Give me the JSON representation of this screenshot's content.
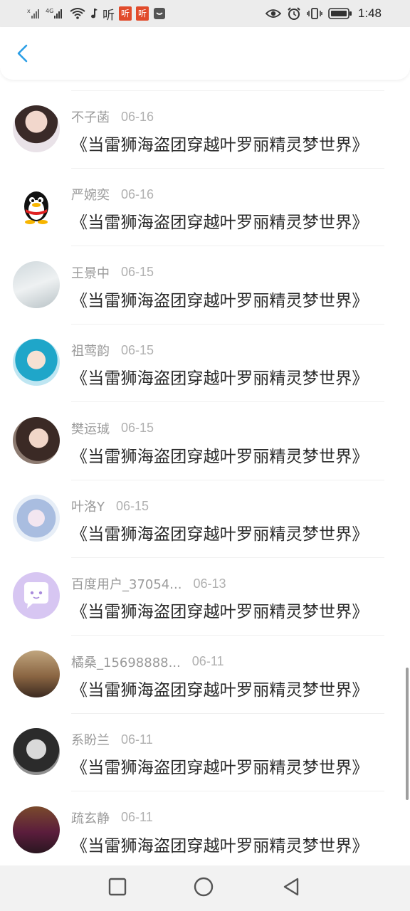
{
  "status_bar": {
    "left_icons": [
      "signal-off-icon",
      "signal-4g-icon",
      "wifi-icon",
      "music-note-icon"
    ],
    "ting_text": "听",
    "time": "1:48",
    "right_icons": [
      "eye-icon",
      "alarm-icon",
      "vibrate-icon",
      "battery-icon"
    ]
  },
  "header": {
    "back_icon": "chevron-left-icon"
  },
  "colors": {
    "accent": "#2a9ee6",
    "username": "#9a9a9a",
    "title": "#2a2a2a",
    "navbar": "#f2f2f2"
  },
  "comments": [
    {
      "user": "不子菡",
      "date": "06-16",
      "title": "《当雷狮海盗团穿越叶罗丽精灵梦世界》"
    },
    {
      "user": "严婉奕",
      "date": "06-16",
      "title": "《当雷狮海盗团穿越叶罗丽精灵梦世界》"
    },
    {
      "user": "王景中",
      "date": "06-15",
      "title": "《当雷狮海盗团穿越叶罗丽精灵梦世界》"
    },
    {
      "user": "祖莺韵",
      "date": "06-15",
      "title": "《当雷狮海盗团穿越叶罗丽精灵梦世界》"
    },
    {
      "user": "樊运珹",
      "date": "06-15",
      "title": "《当雷狮海盗团穿越叶罗丽精灵梦世界》"
    },
    {
      "user": "叶洛Y",
      "date": "06-15",
      "title": "《当雷狮海盗团穿越叶罗丽精灵梦世界》"
    },
    {
      "user": "百度用户_37054...",
      "date": "06-13",
      "title": "《当雷狮海盗团穿越叶罗丽精灵梦世界》"
    },
    {
      "user": "橘桑_15698888...",
      "date": "06-11",
      "title": "《当雷狮海盗团穿越叶罗丽精灵梦世界》"
    },
    {
      "user": "系盼兰",
      "date": "06-11",
      "title": "《当雷狮海盗团穿越叶罗丽精灵梦世界》"
    },
    {
      "user": "疏玄静",
      "date": "06-11",
      "title": "《当雷狮海盗团穿越叶罗丽精灵梦世界》"
    }
  ],
  "nav": {
    "icons": [
      "recent-apps-icon",
      "home-icon",
      "back-triangle-icon"
    ]
  }
}
